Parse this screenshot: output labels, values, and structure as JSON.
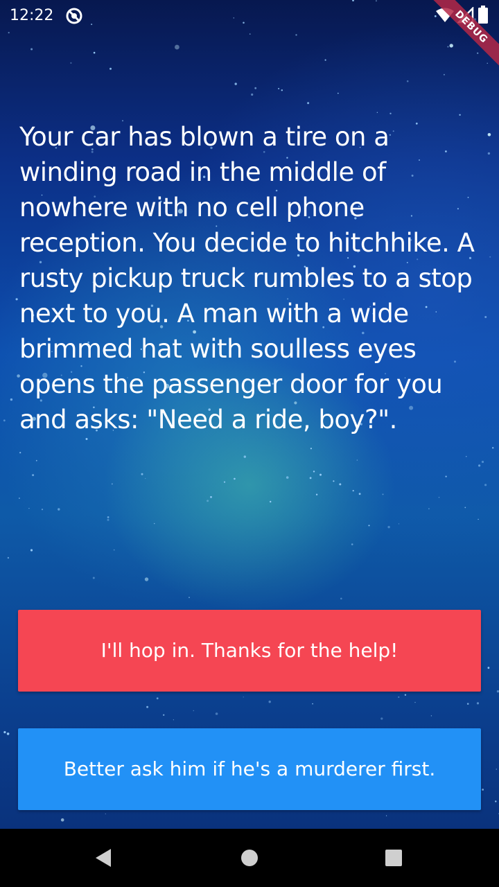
{
  "status_bar": {
    "time": "12:22",
    "app_icon": "sync-disabled-icon",
    "wifi_icon": "wifi-icon",
    "signal_icon": "signal-icon",
    "battery_icon": "battery-icon",
    "debug_label": "DEBUG"
  },
  "story": {
    "text": "Your car has blown a tire on a winding road in the middle of nowhere with no cell phone reception. You decide to hitchhike. A rusty pickup truck rumbles to a stop next to you. A man with a wide brimmed hat with soulless eyes opens the passenger door for you and asks: \"Need a ride, boy?\"."
  },
  "choices": [
    {
      "label": "I'll hop in. Thanks for the help!",
      "color": "#f54653"
    },
    {
      "label": "Better ask him if he's a murderer first.",
      "color": "#2291f6"
    }
  ],
  "nav_bar": {
    "back_icon": "back-triangle-icon",
    "home_icon": "home-circle-icon",
    "recents_icon": "recents-square-icon"
  }
}
